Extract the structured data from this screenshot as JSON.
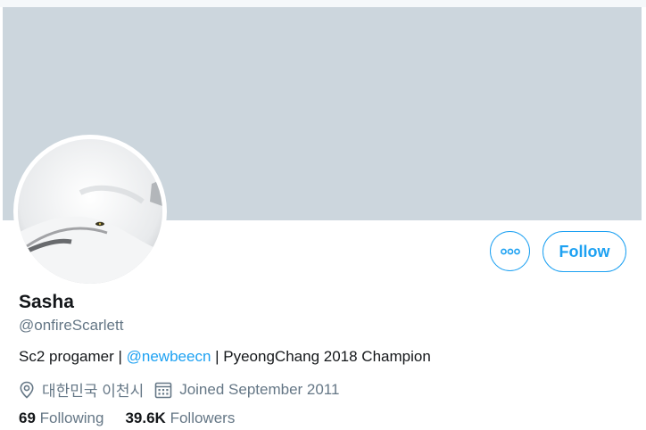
{
  "profile": {
    "name": "Sasha",
    "handle": "@onfireScarlett",
    "bio_prefix": "Sc2 progamer | ",
    "bio_mention": "@newbeecn",
    "bio_suffix": " | PyeongChang 2018 Champion",
    "location": "대한민국 이천시",
    "joined": "Joined September 2011",
    "following_count": "69",
    "following_label": "Following",
    "followers_count": "39.6K",
    "followers_label": "Followers"
  },
  "actions": {
    "follow_label": "Follow",
    "more_icon": "more-horizontal-icon"
  },
  "icons": {
    "location": "location-pin-icon",
    "calendar": "calendar-icon"
  },
  "colors": {
    "accent": "#1da1f2",
    "banner": "#ccd6dd",
    "secondary_text": "#657786"
  }
}
